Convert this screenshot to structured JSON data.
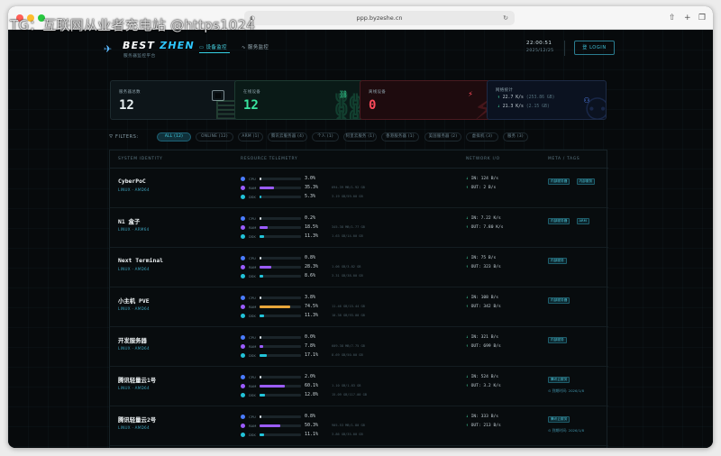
{
  "watermark": "TG：互联网从业者充电站 @https1024",
  "browser": {
    "url": "ppp.byzeshe.cn",
    "traffic_lights": [
      "#ff5f57",
      "#febc2e",
      "#28c840"
    ]
  },
  "nav": {
    "brand_main": "BEST ",
    "brand_accent": "ZHEN",
    "brand_sub": "服务器监控平台",
    "tabs": [
      {
        "label": "设备监控",
        "icon": "monitor-icon",
        "active": true
      },
      {
        "label": "服务监控",
        "icon": "activity-icon",
        "active": false
      }
    ],
    "time": "22:00:51",
    "time_sub": "2025/12/25",
    "login_label": "登 LOGIN"
  },
  "stats": {
    "total": {
      "label": "服务器总数",
      "value": "12"
    },
    "online": {
      "label": "在线设备",
      "value": "12"
    },
    "offline": {
      "label": "离线设备",
      "value": "0"
    },
    "network": {
      "label": "网络统计",
      "up": "22.7 K/s",
      "up_total": "(253.86 GB)",
      "down": "21.3 K/s",
      "down_total": "(2.15 GB)"
    }
  },
  "filters": {
    "label": "FILTERS:",
    "chips": [
      {
        "label": "ALL (12)",
        "active": true
      },
      {
        "label": "ONLINE (12)",
        "active": false
      },
      {
        "label": "ARM (1)",
        "active": false
      },
      {
        "label": "腾讯云服务器 (4)",
        "active": false
      },
      {
        "label": "个人 (1)",
        "active": false
      },
      {
        "label": "阿里云服务 (1)",
        "active": false
      },
      {
        "label": "香港服务器 (1)",
        "active": false
      },
      {
        "label": "美国服务器 (2)",
        "active": false
      },
      {
        "label": "虚拟机 (3)",
        "active": false
      },
      {
        "label": "服务 (3)",
        "active": false
      }
    ]
  },
  "table": {
    "headers": [
      "SYSTEM IDENTITY",
      "RESOURCE TELEMETRY",
      "NETWORK I/O",
      "META / TAGS"
    ],
    "resource_labels": [
      "CPU",
      "RAM",
      "DSK"
    ],
    "rows": [
      {
        "name": "CyberPoC",
        "os": "LINUX · AMD64",
        "cpu": 3.0,
        "cpu_pct": "3.0%",
        "ram": 35.3,
        "ram_pct": "35.3%",
        "ram_detail": "694.39 MB/1.92 GB",
        "dsk": 5.3,
        "dsk_pct": "5.3%",
        "dsk_detail": "3.19 GB/59.00 GB",
        "down": "IN: 124 B/s",
        "up": "OUT: 2 B/s",
        "tags": [
          "内部服务器",
          "内部服务"
        ],
        "expire": ""
      },
      {
        "name": "N1 盒子",
        "os": "LINUX · ARM64",
        "cpu": 0.2,
        "cpu_pct": "0.2%",
        "ram": 18.5,
        "ram_pct": "18.5%",
        "ram_detail": "345.38 MB/1.77 GB",
        "dsk": 11.3,
        "dsk_pct": "11.3%",
        "dsk_detail": "1.63 GB/14.00 GB",
        "down": "IN: 7.22 K/s",
        "up": "OUT: 7.80 K/s",
        "tags": [
          "内部服务器",
          "ARM"
        ],
        "expire": ""
      },
      {
        "name": "Next Terminal",
        "os": "LINUX · AMD64",
        "cpu": 0.8,
        "cpu_pct": "0.8%",
        "ram": 28.3,
        "ram_pct": "28.3%",
        "ram_detail": "1.06 GB/3.82 GB",
        "dsk": 8.6,
        "dsk_pct": "8.6%",
        "dsk_detail": "3.31 GB/38.00 GB",
        "down": "IN: 75 B/s",
        "up": "OUT: 323 B/s",
        "tags": [
          "内部服务"
        ],
        "expire": ""
      },
      {
        "name": "小主机 PVE",
        "os": "LINUX · AMD64",
        "cpu": 3.8,
        "cpu_pct": "3.8%",
        "ram": 74.5,
        "ram_pct": "74.5%",
        "ram_detail": "11.46 GB/15.44 GB",
        "dsk": 11.3,
        "dsk_pct": "11.3%",
        "dsk_detail": "10.38 GB/93.00 GB",
        "down": "IN: 108 B/s",
        "up": "OUT: 342 B/s",
        "tags": [
          "内部服务器"
        ],
        "expire": ""
      },
      {
        "name": "开发服务器",
        "os": "LINUX · AMD64",
        "cpu": 0.0,
        "cpu_pct": "0.0%",
        "ram": 7.8,
        "ram_pct": "7.8%",
        "ram_detail": "609.38 MB/7.75 GB",
        "dsk": 17.1,
        "dsk_pct": "17.1%",
        "dsk_detail": "8.69 GB/50.00 GB",
        "down": "IN: 321 B/s",
        "up": "OUT: 699 B/s",
        "tags": [
          "内部服务"
        ],
        "expire": ""
      },
      {
        "name": "腾讯轻量云1号",
        "os": "LINUX · AMD64",
        "cpu": 2.0,
        "cpu_pct": "2.0%",
        "ram": 60.1,
        "ram_pct": "60.1%",
        "ram_detail": "1.10 GB/1.83 GB",
        "dsk": 12.8,
        "dsk_pct": "12.8%",
        "dsk_detail": "15.09 GB/117.00 GB",
        "down": "IN: 524 B/s",
        "up": "OUT: 3.2 K/s",
        "tags": [
          "腾讯云服务"
        ],
        "expire": "⊙ 到期时间: 2026/1/8"
      },
      {
        "name": "腾讯轻量云2号",
        "os": "LINUX · AMD64",
        "cpu": 0.8,
        "cpu_pct": "0.8%",
        "ram": 50.3,
        "ram_pct": "50.3%",
        "ram_detail": "905.53 MB/1.80 GB",
        "dsk": 11.1,
        "dsk_pct": "11.1%",
        "dsk_detail": "3.86 GB/35.00 GB",
        "down": "IN: 333 B/s",
        "up": "OUT: 213 B/s",
        "tags": [
          "腾讯云服务"
        ],
        "expire": "⊙ 到期时间: 2026/1/8"
      }
    ]
  },
  "colors": {
    "accent": "#2ec7ff",
    "online": "#39e6a0",
    "offline": "#ff4a5a",
    "cpu_icon": "#4a7cff",
    "ram_icon": "#9b5cff",
    "dsk_icon": "#22c3d8",
    "cpu_bar": "#d8e0e4",
    "ram_bar": "#9b5cff",
    "ram_bar_high": "#e8a63a",
    "dsk_bar": "#22c3d8"
  }
}
